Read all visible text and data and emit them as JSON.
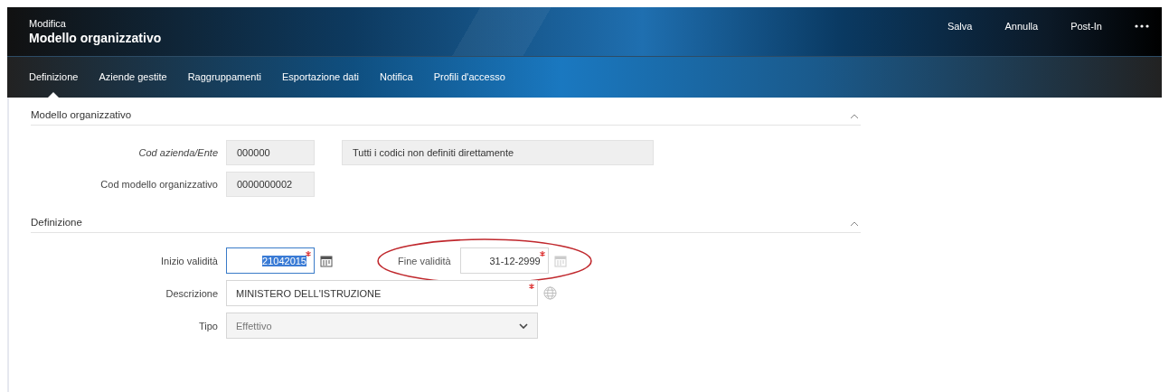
{
  "header": {
    "subtitle": "Modifica",
    "title": "Modello organizzativo",
    "actions": [
      "Salva",
      "Annulla",
      "Post-In"
    ]
  },
  "tabs": [
    {
      "label": "Definizione",
      "selected": true
    },
    {
      "label": "Aziende gestite",
      "selected": false
    },
    {
      "label": "Raggruppamenti",
      "selected": false
    },
    {
      "label": "Esportazione dati",
      "selected": false
    },
    {
      "label": "Notifica",
      "selected": false
    },
    {
      "label": "Profili d'accesso",
      "selected": false
    }
  ],
  "sections": [
    {
      "title": "Modello organizzativo",
      "expanded": true,
      "rows": [
        {
          "fields": [
            {
              "kind": "readonly",
              "label": "Cod azienda/Ente",
              "italic": true,
              "value": "000000",
              "description": "Tutti i codici non definiti direttamente"
            }
          ]
        },
        {
          "fields": [
            {
              "kind": "readonly",
              "label": "Cod modello organizzativo",
              "italic": false,
              "value": "0000000002"
            }
          ]
        }
      ]
    },
    {
      "title": "Definizione",
      "expanded": true,
      "rows": [
        {
          "fields": [
            {
              "kind": "date",
              "label": "Inizio validità",
              "value": "21042015",
              "required": true,
              "focused": true,
              "disabled": false,
              "circled": false
            },
            {
              "kind": "date",
              "label": "Fine validità",
              "value": "31-12-2999",
              "required": true,
              "focused": false,
              "disabled": true,
              "circled": true
            }
          ]
        },
        {
          "fields": [
            {
              "kind": "text",
              "label": "Descrizione",
              "value": "MINISTERO DELL'ISTRUZIONE",
              "required": true
            }
          ]
        },
        {
          "fields": [
            {
              "kind": "select",
              "label": "Tipo",
              "value": "Effettivo",
              "disabled": true
            }
          ]
        }
      ]
    }
  ]
}
